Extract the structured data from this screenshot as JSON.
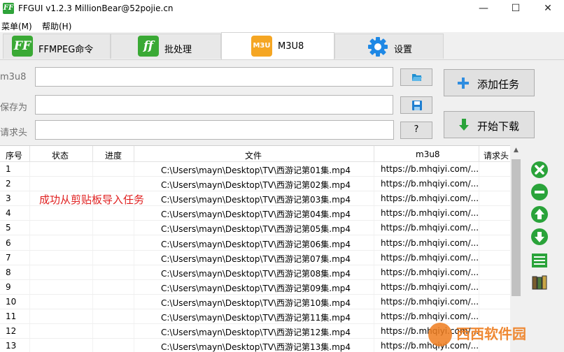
{
  "window": {
    "title": "FFGUI v1.2.3   MillionBear@52pojie.cn",
    "app_icon_text": "FF",
    "minimize_glyph": "—",
    "maximize_glyph": "☐",
    "close_glyph": "✕"
  },
  "menu": [
    "菜单(M)",
    "帮助(H)"
  ],
  "tabs": [
    {
      "label": "FFMPEG命令",
      "icon": "FF"
    },
    {
      "label": "批处理",
      "icon": "ff"
    },
    {
      "label": "M3U8",
      "icon": "M3U"
    },
    {
      "label": "设置",
      "icon": "gear-icon"
    }
  ],
  "form": {
    "m3u8_label": "m3u8",
    "saveas_label": "保存为",
    "header_label": "请求头",
    "m3u8_value": "",
    "saveas_value": "",
    "header_value": "",
    "help_button": "?"
  },
  "buttons": {
    "add_task": "添加任务",
    "start_download": "开始下载"
  },
  "table": {
    "columns": [
      "序号",
      "状态",
      "进度",
      "文件",
      "m3u8",
      "请求头"
    ],
    "rows": [
      {
        "num": "1",
        "file": "C:\\Users\\mayn\\Desktop\\TV\\西游记第01集.mp4",
        "url": "https://b.mhqiyi.com/..."
      },
      {
        "num": "2",
        "file": "C:\\Users\\mayn\\Desktop\\TV\\西游记第02集.mp4",
        "url": "https://b.mhqiyi.com/..."
      },
      {
        "num": "3",
        "file": "C:\\Users\\mayn\\Desktop\\TV\\西游记第03集.mp4",
        "url": "https://b.mhqiyi.com/..."
      },
      {
        "num": "4",
        "file": "C:\\Users\\mayn\\Desktop\\TV\\西游记第04集.mp4",
        "url": "https://b.mhqiyi.com/..."
      },
      {
        "num": "5",
        "file": "C:\\Users\\mayn\\Desktop\\TV\\西游记第05集.mp4",
        "url": "https://b.mhqiyi.com/..."
      },
      {
        "num": "6",
        "file": "C:\\Users\\mayn\\Desktop\\TV\\西游记第06集.mp4",
        "url": "https://b.mhqiyi.com/..."
      },
      {
        "num": "7",
        "file": "C:\\Users\\mayn\\Desktop\\TV\\西游记第07集.mp4",
        "url": "https://b.mhqiyi.com/..."
      },
      {
        "num": "8",
        "file": "C:\\Users\\mayn\\Desktop\\TV\\西游记第08集.mp4",
        "url": "https://b.mhqiyi.com/..."
      },
      {
        "num": "9",
        "file": "C:\\Users\\mayn\\Desktop\\TV\\西游记第09集.mp4",
        "url": "https://b.mhqiyi.com/..."
      },
      {
        "num": "10",
        "file": "C:\\Users\\mayn\\Desktop\\TV\\西游记第10集.mp4",
        "url": "https://b.mhqiyi.com/..."
      },
      {
        "num": "11",
        "file": "C:\\Users\\mayn\\Desktop\\TV\\西游记第11集.mp4",
        "url": "https://b.mhqiyi.com/..."
      },
      {
        "num": "12",
        "file": "C:\\Users\\mayn\\Desktop\\TV\\西游记第12集.mp4",
        "url": "https://b.mhqiyi.com/..."
      },
      {
        "num": "13",
        "file": "C:\\Users\\mayn\\Desktop\\TV\\西游记第13集.mp4",
        "url": "https://b.mhqiyi.com/..."
      }
    ]
  },
  "status_toast": "成功从剪贴板导入任务",
  "watermark": "西西软件园",
  "colors": {
    "accent_green": "#2aa33a",
    "toast_red": "#e02020",
    "m3u_orange": "#f5a623",
    "gear_blue": "#1e88e5"
  }
}
